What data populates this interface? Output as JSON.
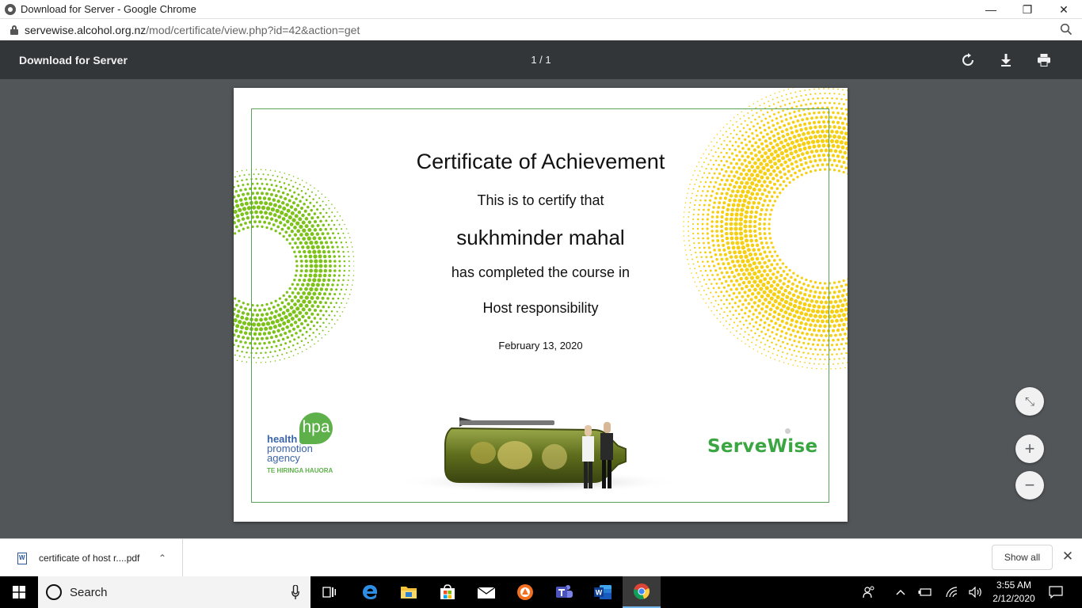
{
  "window": {
    "title": "Download for Server - Google Chrome",
    "minimize": "—",
    "restore": "❐",
    "close": "✕"
  },
  "address": {
    "host": "servewise.alcohol.org.nz",
    "path": "/mod/certificate/view.php?id=42&action=get"
  },
  "pdf_toolbar": {
    "title": "Download for Server",
    "page_indicator": "1 / 1"
  },
  "certificate": {
    "heading": "Certificate of Achievement",
    "certify_line": "This is to certify that",
    "recipient": "sukhminder mahal",
    "completed_line": "has completed the course in",
    "course": "Host responsibility",
    "date": "February 13, 2020",
    "hpa_mark": "hpa",
    "hpa_words": [
      "health",
      "promotion",
      "agency"
    ],
    "hpa_maori": "TE HIRINGA HAUORA",
    "servewise_logo": "ServeWise"
  },
  "zoom_controls": {
    "fit": "⤡",
    "zoom_in": "+",
    "zoom_out": "−"
  },
  "downloads": {
    "file_name": "certificate of host r....pdf",
    "show_all": "Show all",
    "close": "✕"
  },
  "taskbar": {
    "search_placeholder": "Search",
    "time": "3:55 AM",
    "date": "2/12/2020"
  },
  "colors": {
    "pdf_toolbar_bg": "#323639",
    "viewer_bg": "#525659",
    "cert_border": "#5aa25a",
    "green_dots": "#7cc219",
    "yellow_dots": "#f6cf12",
    "servewise_green": "#3aa641",
    "hpa_blue": "#3a64a8"
  }
}
